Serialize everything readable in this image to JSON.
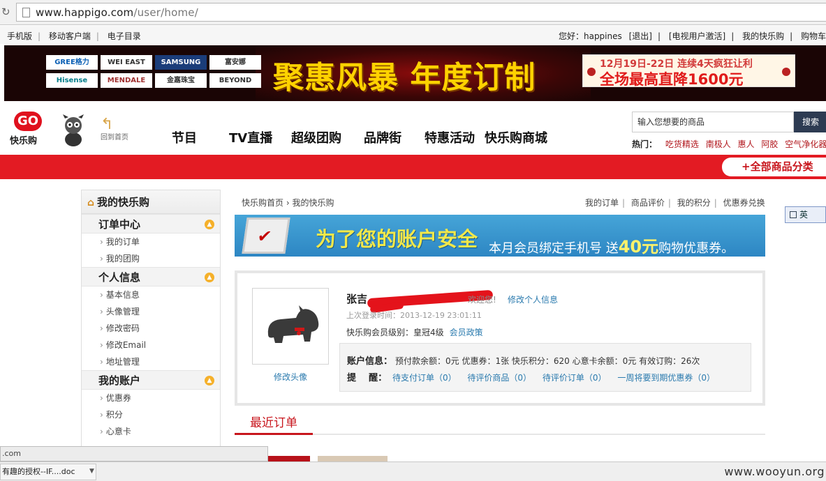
{
  "browser": {
    "url_host": "www.happigo.com",
    "url_path": "/user/home/"
  },
  "toplinks": {
    "left": [
      "手机版",
      "移动客户端",
      "电子目录"
    ],
    "greeting": "您好：happines",
    "logout": "[退出]",
    "tv_activate": "[电视用户激活]",
    "my_happigo": "我的快乐购",
    "cart": "购物车"
  },
  "banner": {
    "brands": [
      "GREE格力",
      "WEI EAST",
      "SAMSUNG",
      "富安娜",
      "Hisense",
      "MENDALE",
      "金嘉珠宝",
      "BEYOND"
    ],
    "title": "聚惠风暴 年度订制",
    "promo_line1": "12月19日-22日 连续4天疯狂让利",
    "promo_line2": "全场最高直降1600元"
  },
  "header": {
    "logo_text": "快乐购",
    "back_home": "回到首页",
    "nav": [
      "节目",
      "TV直播",
      "超级团购",
      "品牌街",
      "特惠活动",
      "快乐购商城"
    ],
    "search_placeholder": "输入您想要的商品",
    "search_button": "搜索",
    "hot_label": "热门：",
    "hot_items": [
      "吃货精选",
      "南极人",
      "惠人",
      "阿胶",
      "空气净化器"
    ],
    "all_categories": "+全部商品分类"
  },
  "sidebar": {
    "title": "我的快乐购",
    "groups": [
      {
        "title": "订单中心",
        "items": [
          "我的订单",
          "我的团购"
        ]
      },
      {
        "title": "个人信息",
        "items": [
          "基本信息",
          "头像管理",
          "修改密码",
          "修改Email",
          "地址管理"
        ]
      },
      {
        "title": "我的账户",
        "items": [
          "优惠券",
          "积分",
          "心意卡"
        ]
      }
    ]
  },
  "main": {
    "breadcrumb_home": "快乐购首页",
    "breadcrumb_current": "我的快乐购",
    "quick_links": [
      "我的订单",
      "商品评价",
      "我的积分",
      "优惠券兑换"
    ],
    "security_big": "为了您的账户安全",
    "security_small_pre": "本月会员绑定手机号 送",
    "security_amount": "40元",
    "security_small_post": "购物优惠券。",
    "user_name": "张吉",
    "welcome": "欢迎您!",
    "edit_profile": "修改个人信息",
    "last_login": "上次登录时间：2013-12-19 23:01:11",
    "level_label": "快乐购会员级别：皇冠4级",
    "member_policy": "会员政策",
    "change_avatar": "修改头像",
    "account_label": "账户信息：",
    "account_values": "预付款余额：0元  优惠券：1张  快乐积分：620  心意卡余额：0元  有效订购：26次",
    "remind_label": "提    醒：",
    "reminders": [
      "待支付订单（0）",
      "待评价商品（0）",
      "待评价订单（0）",
      "一周将要到期优惠券（0）"
    ],
    "recent_orders": "最近订单"
  },
  "ime": "英",
  "status_url": ".com",
  "taskbar": {
    "download": "有趣的授权--IF....doc",
    "watermark": "www.wooyun.org"
  }
}
